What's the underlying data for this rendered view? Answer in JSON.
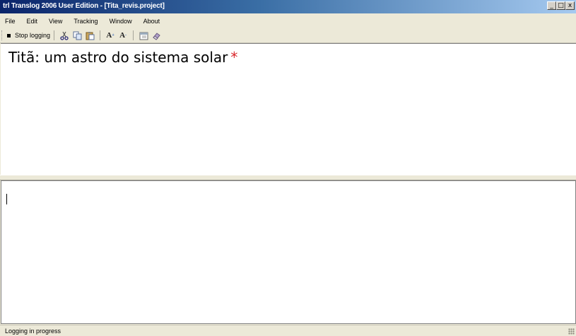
{
  "window": {
    "title": "trl Translog 2006 User Edition - [Tita_revis.project]",
    "controls": {
      "minimize": "_",
      "maximize": "□",
      "close": "x"
    }
  },
  "menu": {
    "items": [
      {
        "label": "File"
      },
      {
        "label": "Edit"
      },
      {
        "label": "View"
      },
      {
        "label": "Tracking"
      },
      {
        "label": "Window"
      },
      {
        "label": "About"
      }
    ]
  },
  "toolbar": {
    "stop_logging_label": "Stop logging",
    "icons": [
      "cut-icon",
      "copy-icon",
      "paste-icon",
      "font-increase-icon",
      "font-decrease-icon",
      "calendar-icon",
      "eraser-icon"
    ]
  },
  "source_pane": {
    "text": "Titã: um astro do sistema solar",
    "marker": "*",
    "marker_color": "#d9262a"
  },
  "target_pane": {
    "text": ""
  },
  "statusbar": {
    "text": "Logging in progress"
  },
  "colors": {
    "title_gradient_start": "#0a246a",
    "title_gradient_end": "#a6caf0",
    "chrome": "#ece9d8"
  }
}
